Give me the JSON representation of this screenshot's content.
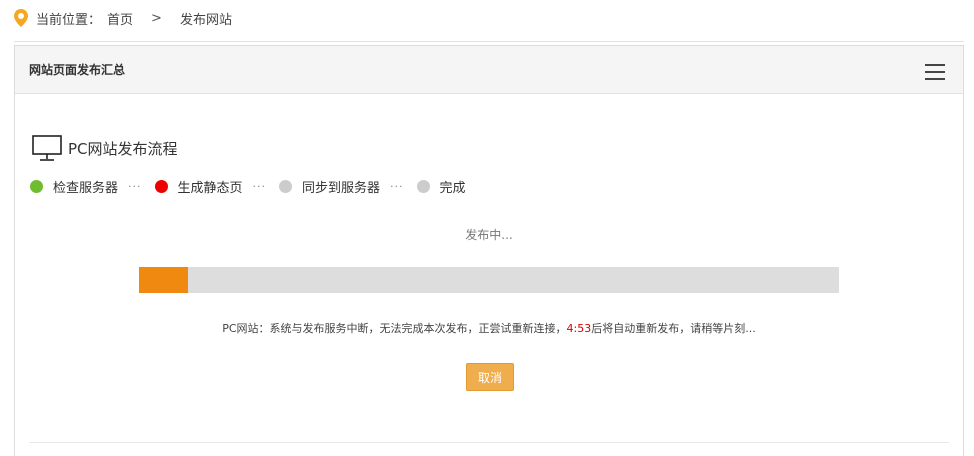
{
  "breadcrumb": {
    "label": "当前位置：",
    "home": "首页",
    "separator": ">",
    "current": "发布网站",
    "icon": "location-pin-icon"
  },
  "panel": {
    "title": "网站页面发布汇总",
    "menu_icon": "hamburger-menu-icon"
  },
  "process": {
    "icon": "monitor-icon",
    "title": "PC网站发布流程",
    "steps": [
      {
        "label": "检查服务器",
        "color": "#6fbd2f"
      },
      {
        "label": "生成静态页",
        "color": "#ee0000"
      },
      {
        "label": "同步到服务器",
        "color": "#cccccc"
      },
      {
        "label": "完成",
        "color": "#cccccc"
      }
    ],
    "separator": "···"
  },
  "status": "发布中...",
  "progress": {
    "percent": 7,
    "color": "#f0890f"
  },
  "message": {
    "prefix": "PC网站：系统与发布服务中断，无法完成本次发布，正尝试重新连接，",
    "countdown": "4:53",
    "suffix": "后将自动重新发布，请稍等片刻..."
  },
  "cancel_label": "取消"
}
